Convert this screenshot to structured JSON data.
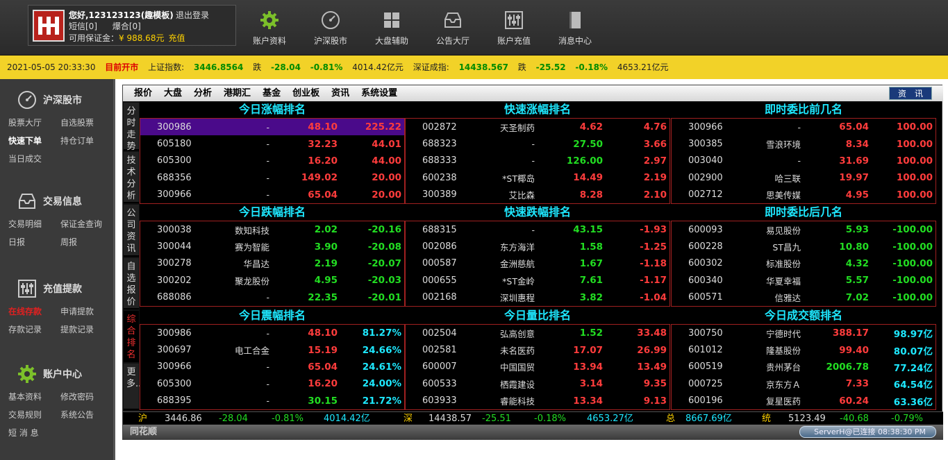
{
  "user": {
    "greeting": "您好,123123123(趣模板)",
    "logout": "退出登录",
    "sms": "短信[0]",
    "blast": "爆合[0]",
    "margin_label": "可用保证金：",
    "margin_value": "¥ 988.68元",
    "recharge": "充值"
  },
  "top_nav": [
    {
      "label": "账户资料",
      "icon": "gear-icon"
    },
    {
      "label": "沪深股市",
      "icon": "gauge-icon"
    },
    {
      "label": "大盘辅助",
      "icon": "grid-icon"
    },
    {
      "label": "公告大厅",
      "icon": "inbox-icon"
    },
    {
      "label": "账户充值",
      "icon": "sliders-icon"
    },
    {
      "label": "消息中心",
      "icon": "book-icon"
    }
  ],
  "ticker": {
    "datetime": "2021-05-05 20:33:30",
    "status": "目前开市",
    "sh_label": "上证指数:",
    "sh_value": "3446.8564",
    "sh_dir": "跌",
    "sh_change": "-28.04",
    "sh_pct": "-0.81%",
    "sh_amount": "4014.42亿元",
    "sz_label": "深证成指:",
    "sz_value": "14438.567",
    "sz_dir": "跌",
    "sz_change": "-25.52",
    "sz_pct": "-0.18%",
    "sz_amount": "4653.21亿元"
  },
  "sidebar": {
    "sections": [
      {
        "title": "沪深股市",
        "icon": "gauge-icon",
        "rows": [
          [
            "股票大厅",
            "自选股票"
          ],
          [
            "快速下单",
            "持仓订单"
          ],
          [
            "当日成交",
            ""
          ]
        ]
      },
      {
        "title": "交易信息",
        "icon": "inbox-icon",
        "rows": [
          [
            "交易明细",
            "保证金查询"
          ],
          [
            "日报",
            "周报"
          ]
        ]
      },
      {
        "title": "充值提款",
        "icon": "sliders-icon",
        "rows": [
          [
            "在线存款",
            "申请提款"
          ],
          [
            "存款记录",
            "提款记录"
          ]
        ]
      },
      {
        "title": "账户中心",
        "icon": "gear-icon",
        "rows": [
          [
            "基本资料",
            "修改密码"
          ],
          [
            "交易规则",
            "系统公告"
          ],
          [
            "短 消 息",
            ""
          ]
        ]
      }
    ]
  },
  "menu": [
    "报价",
    "大盘",
    "分析",
    "港期汇",
    "基金",
    "创业板",
    "资讯",
    "系统设置"
  ],
  "news_button": "资　讯",
  "vtabs": [
    "分时走势",
    "技术分析",
    "公司资讯",
    "自选报价",
    "综合排名",
    "更多.."
  ],
  "panels": [
    {
      "title": "今日涨幅排名",
      "rows": [
        [
          "300986",
          "-",
          "48.10",
          "225.22"
        ],
        [
          "605180",
          "-",
          "32.23",
          "44.01"
        ],
        [
          "605300",
          "-",
          "16.20",
          "44.00"
        ],
        [
          "688356",
          "-",
          "149.02",
          "20.00"
        ],
        [
          "300966",
          "-",
          "65.04",
          "20.00"
        ]
      ]
    },
    {
      "title": "快速涨幅排名",
      "rows": [
        [
          "002872",
          "天圣制药",
          "4.62",
          "4.76"
        ],
        [
          "688323",
          "-",
          "27.50",
          "3.66"
        ],
        [
          "688333",
          "-",
          "126.00",
          "2.97"
        ],
        [
          "600238",
          "*ST椰岛",
          "14.49",
          "2.19"
        ],
        [
          "300389",
          "艾比森",
          "8.28",
          "2.10"
        ]
      ]
    },
    {
      "title": "即时委比前几名",
      "rows": [
        [
          "300966",
          "-",
          "65.04",
          "100.00"
        ],
        [
          "300385",
          "雪浪环境",
          "8.34",
          "100.00"
        ],
        [
          "003040",
          "-",
          "31.69",
          "100.00"
        ],
        [
          "002900",
          "哈三联",
          "19.97",
          "100.00"
        ],
        [
          "002712",
          "思美传媒",
          "4.95",
          "100.00"
        ]
      ]
    },
    {
      "title": "今日跌幅排名",
      "rows": [
        [
          "300038",
          "数知科技",
          "2.02",
          "-20.16"
        ],
        [
          "300044",
          "赛为智能",
          "3.90",
          "-20.08"
        ],
        [
          "300278",
          "华昌达",
          "2.19",
          "-20.07"
        ],
        [
          "300202",
          "聚龙股份",
          "4.95",
          "-20.03"
        ],
        [
          "688086",
          "-",
          "22.35",
          "-20.01"
        ]
      ]
    },
    {
      "title": "快速跌幅排名",
      "rows": [
        [
          "688315",
          "-",
          "43.15",
          "-1.93"
        ],
        [
          "002086",
          "东方海洋",
          "1.58",
          "-1.25"
        ],
        [
          "000587",
          "金洲慈航",
          "1.67",
          "-1.18"
        ],
        [
          "000655",
          "*ST金岭",
          "7.61",
          "-1.17"
        ],
        [
          "002168",
          "深圳惠程",
          "3.82",
          "-1.04"
        ]
      ]
    },
    {
      "title": "即时委比后几名",
      "rows": [
        [
          "600093",
          "易见股份",
          "5.93",
          "-100.00"
        ],
        [
          "600228",
          "ST昌九",
          "10.80",
          "-100.00"
        ],
        [
          "600302",
          "标准股份",
          "4.32",
          "-100.00"
        ],
        [
          "600340",
          "华夏幸福",
          "5.57",
          "-100.00"
        ],
        [
          "600571",
          "信雅达",
          "7.02",
          "-100.00"
        ]
      ]
    },
    {
      "title": "今日震幅排名",
      "rows": [
        [
          "300986",
          "-",
          "48.10",
          "81.27%"
        ],
        [
          "300697",
          "电工合金",
          "15.19",
          "24.66%"
        ],
        [
          "300966",
          "-",
          "65.04",
          "24.61%"
        ],
        [
          "605300",
          "-",
          "16.20",
          "24.00%"
        ],
        [
          "688395",
          "-",
          "30.15",
          "21.72%"
        ]
      ]
    },
    {
      "title": "今日量比排名",
      "rows": [
        [
          "002504",
          "弘高创意",
          "1.52",
          "33.48"
        ],
        [
          "002581",
          "未名医药",
          "17.07",
          "26.99"
        ],
        [
          "600007",
          "中国国贸",
          "13.94",
          "13.49"
        ],
        [
          "600533",
          "栖霞建设",
          "3.14",
          "9.35"
        ],
        [
          "603933",
          "睿能科技",
          "13.34",
          "9.13"
        ]
      ]
    },
    {
      "title": "今日成交额排名",
      "rows": [
        [
          "300750",
          "宁德时代",
          "388.17",
          "98.97亿"
        ],
        [
          "601012",
          "隆基股份",
          "99.40",
          "80.07亿"
        ],
        [
          "600519",
          "贵州茅台",
          "2006.78",
          "77.24亿"
        ],
        [
          "000725",
          "京东方Ａ",
          "7.33",
          "64.54亿"
        ],
        [
          "600196",
          "复星医药",
          "60.24",
          "63.36亿"
        ]
      ]
    }
  ],
  "panel_colors": [
    [
      [
        "red",
        "red"
      ],
      [
        "red",
        "red"
      ],
      [
        "red",
        "red"
      ],
      [
        "red",
        "red"
      ],
      [
        "red",
        "red"
      ]
    ],
    [
      [
        "red",
        "red"
      ],
      [
        "grn",
        "red"
      ],
      [
        "grn",
        "red"
      ],
      [
        "red",
        "red"
      ],
      [
        "red",
        "red"
      ]
    ],
    [
      [
        "red",
        "red"
      ],
      [
        "red",
        "red"
      ],
      [
        "red",
        "red"
      ],
      [
        "red",
        "red"
      ],
      [
        "red",
        "red"
      ]
    ],
    [
      [
        "grn",
        "grn"
      ],
      [
        "grn",
        "grn"
      ],
      [
        "grn",
        "grn"
      ],
      [
        "grn",
        "grn"
      ],
      [
        "grn",
        "grn"
      ]
    ],
    [
      [
        "grn",
        "red"
      ],
      [
        "grn",
        "red"
      ],
      [
        "grn",
        "red"
      ],
      [
        "grn",
        "red"
      ],
      [
        "grn",
        "red"
      ]
    ],
    [
      [
        "grn",
        "grn"
      ],
      [
        "grn",
        "grn"
      ],
      [
        "grn",
        "grn"
      ],
      [
        "grn",
        "grn"
      ],
      [
        "grn",
        "grn"
      ]
    ],
    [
      [
        "red",
        "cyn"
      ],
      [
        "red",
        "cyn"
      ],
      [
        "red",
        "cyn"
      ],
      [
        "red",
        "cyn"
      ],
      [
        "grn",
        "cyn"
      ]
    ],
    [
      [
        "grn",
        "red"
      ],
      [
        "red",
        "red"
      ],
      [
        "red",
        "red"
      ],
      [
        "red",
        "red"
      ],
      [
        "red",
        "red"
      ]
    ],
    [
      [
        "red",
        "cyn"
      ],
      [
        "red",
        "cyn"
      ],
      [
        "grn",
        "cyn"
      ],
      [
        "red",
        "cyn"
      ],
      [
        "red",
        "cyn"
      ]
    ]
  ],
  "statbar": {
    "sh": "沪",
    "sh_idx": "3446.86",
    "sh_chg": "-28.04",
    "sh_pct": "-0.81%",
    "sh_amt": "4014.42亿",
    "sz": "深",
    "sz_idx": "14438.57",
    "sz_chg": "-25.51",
    "sz_pct": "-0.18%",
    "sz_amt": "4653.27亿",
    "tot": "总",
    "tot_amt": "8667.69亿",
    "cy": "统",
    "cy_idx": "5123.49",
    "cy_chg": "-40.68",
    "cy_pct": "-0.79%"
  },
  "footer": {
    "brand": "同花顺",
    "server": "ServerH@已连接 08:38:30 PM"
  },
  "colors": {
    "up": "#ff3c3c",
    "down": "#22dd22",
    "title": "#1ee8ff",
    "ticker_bg": "#f2d228",
    "selected_row": "#4a0a8a"
  }
}
